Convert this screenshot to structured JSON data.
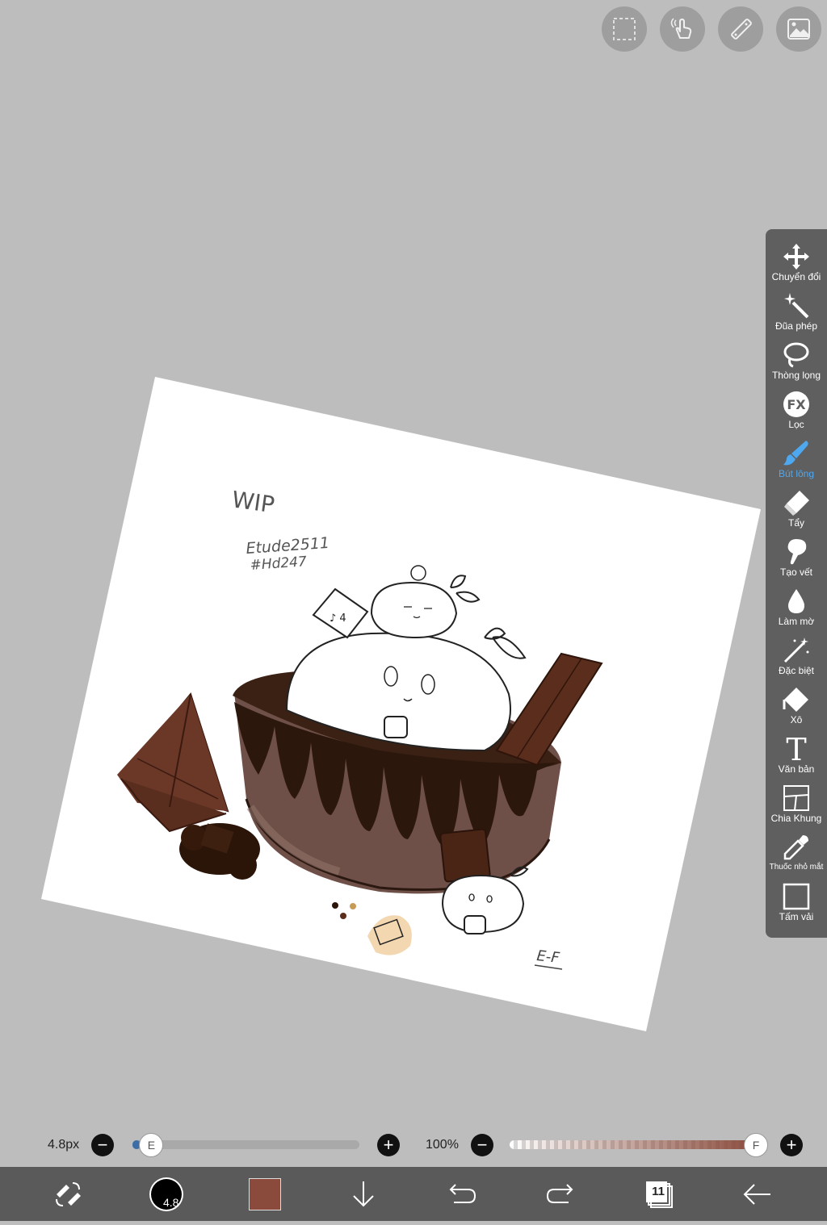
{
  "top_toolbar": {
    "buttons": [
      {
        "name": "selection-icon"
      },
      {
        "name": "hand-gesture-icon"
      },
      {
        "name": "ruler-icon"
      },
      {
        "name": "image-material-icon"
      }
    ]
  },
  "canvas": {
    "handwritten_text": [
      "WIP",
      "Etude2511",
      "#Hd247",
      "E-F"
    ],
    "palette": {
      "paper": "#ffffff",
      "cup_rim": "#3b2114",
      "cup_body": "#6e5048",
      "drip": "#2c170d",
      "chocolate_bar": "#5a2d1c",
      "wafer_triangle": "#5e2f1f",
      "cookie_tag": "#f2d7b0"
    }
  },
  "tools": [
    {
      "id": "move",
      "label": "Chuyển đổi",
      "icon": "move-arrows-icon"
    },
    {
      "id": "magic",
      "label": "Đũa phép",
      "icon": "magic-wand-icon"
    },
    {
      "id": "lasso",
      "label": "Thòng lọng",
      "icon": "lasso-icon"
    },
    {
      "id": "filter",
      "label": "Lọc",
      "icon": "fx-filter-icon"
    },
    {
      "id": "brush",
      "label": "Bút lông",
      "icon": "brush-icon",
      "active": true
    },
    {
      "id": "eraser",
      "label": "Tẩy",
      "icon": "eraser-icon"
    },
    {
      "id": "smudge",
      "label": "Tạo vết",
      "icon": "smudge-icon"
    },
    {
      "id": "blur",
      "label": "Làm mờ",
      "icon": "blur-drop-icon"
    },
    {
      "id": "special",
      "label": "Đặc biệt",
      "icon": "special-wand-icon"
    },
    {
      "id": "bucket",
      "label": "Xô",
      "icon": "bucket-icon"
    },
    {
      "id": "text",
      "label": "Văn bản",
      "icon": "text-icon"
    },
    {
      "id": "frame",
      "label": "Chia Khung",
      "icon": "frame-divider-icon"
    },
    {
      "id": "eyedropper",
      "label": "Thuốc nhỏ mắt",
      "icon": "eyedropper-icon"
    },
    {
      "id": "canvas",
      "label": "Tấm vải",
      "icon": "canvas-icon"
    }
  ],
  "sliders": {
    "brush_size": {
      "label": "4.8px",
      "value_fraction": 0.03,
      "knob_letter": "E"
    },
    "opacity": {
      "label": "100%",
      "value_fraction": 1.0,
      "knob_letter": "F"
    }
  },
  "bottom_bar": {
    "brush_size_value": "4.8",
    "current_color": "#8a4b3c",
    "layer_count": "11",
    "items": [
      "swap-tools-icon",
      "brush-size-icon",
      "color-swatch",
      "download-icon",
      "undo-icon",
      "redo-icon",
      "layers-icon",
      "back-arrow-icon"
    ]
  },
  "colors": {
    "accent": "#4ea8f0",
    "panel": "#5f5f5f",
    "background": "#bdbdbd",
    "bottom_bar": "#5a5a5a"
  }
}
